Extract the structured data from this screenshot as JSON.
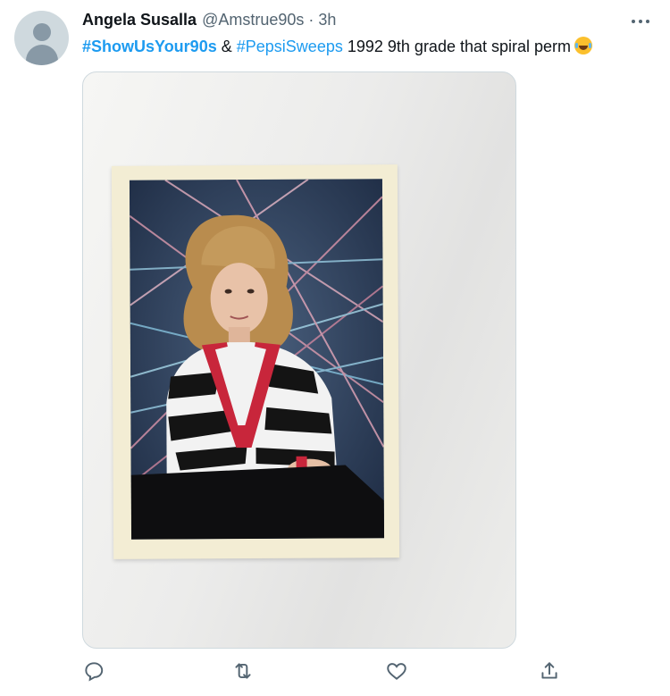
{
  "tweet": {
    "display_name": "Angela Susalla",
    "handle": "@Amstrue90s",
    "separator": "·",
    "time": "3h",
    "hashtag1": "#ShowUsYour90s",
    "ampersand": "&",
    "hashtag2": "#PepsiSweeps",
    "body_text": "1992 9th grade that spiral perm",
    "emoji": "face-with-tears-of-joy"
  },
  "icons": {
    "avatar": "default-avatar-icon",
    "more": "more-options-icon",
    "reply": "reply-icon",
    "retweet": "retweet-icon",
    "like": "like-icon",
    "share": "share-icon"
  },
  "colors": {
    "link": "#1d9bf0",
    "secondary_text": "#536471",
    "primary_text": "#0f1419"
  }
}
